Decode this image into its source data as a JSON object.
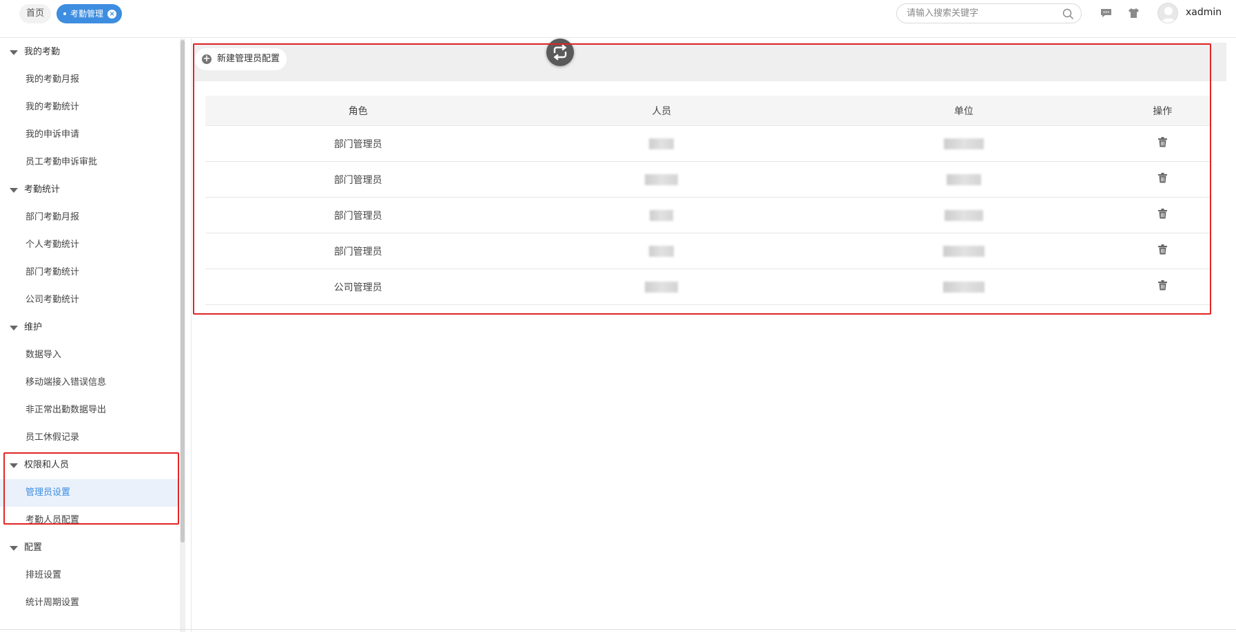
{
  "header": {
    "tabs": [
      {
        "label": "首页",
        "active": false
      },
      {
        "label": "考勤管理",
        "active": true
      }
    ],
    "search_placeholder": "请输入搜索关键字",
    "username": "xadmin"
  },
  "sidebar": {
    "groups": [
      {
        "label": "我的考勤",
        "items": [
          "我的考勤月报",
          "我的考勤统计",
          "我的申诉申请",
          "员工考勤申诉审批"
        ]
      },
      {
        "label": "考勤统计",
        "items": [
          "部门考勤月报",
          "个人考勤统计",
          "部门考勤统计",
          "公司考勤统计"
        ]
      },
      {
        "label": "维护",
        "items": [
          "数据导入",
          "移动端接入错误信息",
          "非正常出勤数据导出",
          "员工休假记录"
        ]
      },
      {
        "label": "权限和人员",
        "items": [
          "管理员设置",
          "考勤人员配置"
        ]
      },
      {
        "label": "配置",
        "items": [
          "排班设置",
          "统计周期设置"
        ]
      }
    ],
    "active_item": "管理员设置"
  },
  "toolbar": {
    "new_button_label": "新建管理员配置"
  },
  "table": {
    "columns": [
      "角色",
      "人员",
      "单位",
      "操作"
    ],
    "rows": [
      {
        "role": "部门管理员"
      },
      {
        "role": "部门管理员"
      },
      {
        "role": "部门管理员"
      },
      {
        "role": "部门管理员"
      },
      {
        "role": "公司管理员"
      }
    ]
  },
  "colors": {
    "accent": "#3d8de0",
    "highlight_border": "#e02424",
    "toolbar_bg": "#efefef"
  }
}
